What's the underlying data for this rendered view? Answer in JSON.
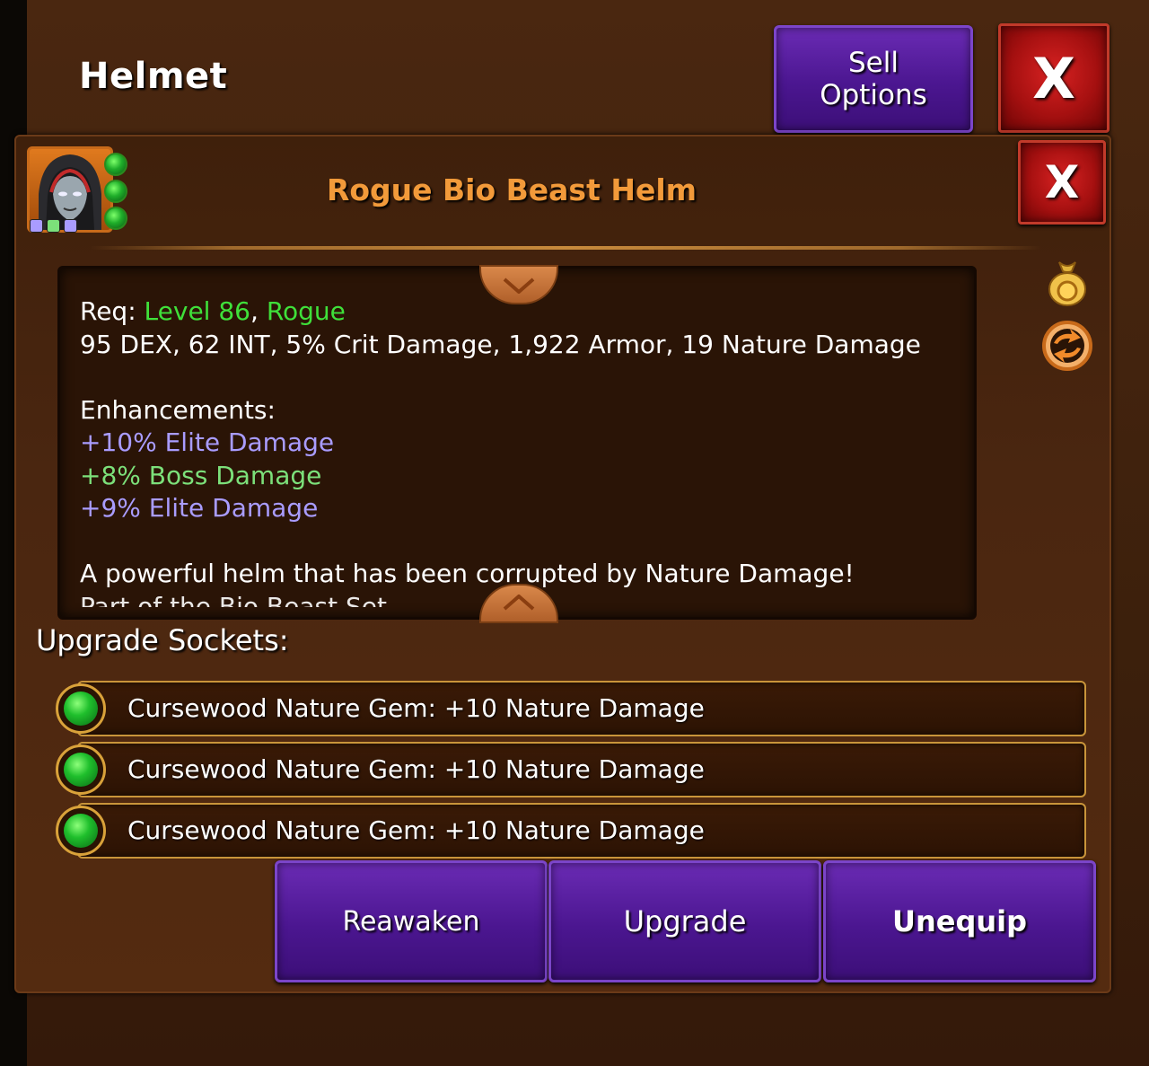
{
  "header": {
    "title": "Helmet"
  },
  "buttons": {
    "sell_options": "Sell\nOptions",
    "close": "X"
  },
  "item": {
    "name": "Rogue Bio Beast Helm",
    "requirement_label": "Req:",
    "requirement_level": "Level 86",
    "requirement_separator": ",",
    "requirement_class": "Rogue",
    "stats": "95 DEX, 62 INT, 5% Crit Damage, 1,922 Armor, 19 Nature Damage",
    "enhancements_label": "Enhancements:",
    "enhancements": [
      {
        "text": "+10% Elite Damage",
        "color": "#a99cff"
      },
      {
        "text": "+8% Boss Damage",
        "color": "#7ce07a"
      },
      {
        "text": "+9% Elite Damage",
        "color": "#a99cff"
      }
    ],
    "description": "A powerful helm that has been corrupted by Nature Damage!",
    "description_partial": "Part of the Bio Beast Set"
  },
  "sockets": {
    "label": "Upgrade Sockets:",
    "items": [
      {
        "text": "Cursewood Nature Gem: +10 Nature Damage"
      },
      {
        "text": "Cursewood Nature Gem: +10 Nature Damage"
      },
      {
        "text": "Cursewood Nature Gem: +10 Nature Damage"
      }
    ]
  },
  "actions": {
    "reawaken": "Reawaken",
    "upgrade": "Upgrade",
    "unequip": "Unequip"
  },
  "icons": {
    "portrait": "hooded-rogue-portrait",
    "gold": "gold-bag-icon",
    "swap": "swap-icon",
    "gem": "nature-gem-icon"
  },
  "colors": {
    "item_name": "#f29a3a",
    "requirement": "#3fe03a",
    "button_purple": "#4b1690",
    "button_red": "#a51010",
    "socket_border": "#c9953a"
  }
}
